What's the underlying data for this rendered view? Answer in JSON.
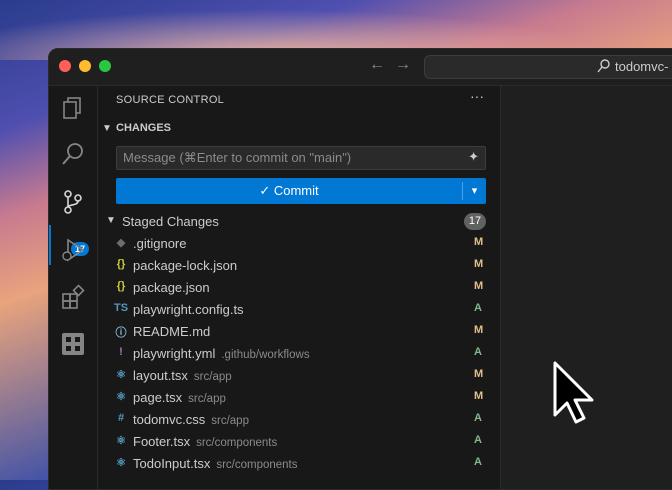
{
  "window": {
    "search_text": "todomvc-"
  },
  "activity_bar": {
    "items": [
      "explorer-icon",
      "search-icon",
      "source-control-icon",
      "run-debug-icon",
      "extensions-icon",
      "remote-icon"
    ],
    "scm_badge": "17",
    "accent": "#0078d4"
  },
  "source_control": {
    "title": "SOURCE CONTROL",
    "more": "···",
    "changes_header": "CHANGES",
    "message_placeholder": "Message (⌘Enter to commit on \"main\")",
    "commit_label": "✓ Commit",
    "staged_label": "Staged Changes",
    "staged_count": "17",
    "files": [
      {
        "icon": "◆",
        "icon_color": "#6d6d6d",
        "name": ".gitignore",
        "dir": "",
        "status": "M"
      },
      {
        "icon": "{}",
        "icon_color": "#cbcb41",
        "name": "package-lock.json",
        "dir": "",
        "status": "M"
      },
      {
        "icon": "{}",
        "icon_color": "#cbcb41",
        "name": "package.json",
        "dir": "",
        "status": "M"
      },
      {
        "icon": "TS",
        "icon_color": "#519aba",
        "name": "playwright.config.ts",
        "dir": "",
        "status": "A"
      },
      {
        "icon": "ⓘ",
        "icon_color": "#8bb8d8",
        "name": "README.md",
        "dir": "",
        "status": "M"
      },
      {
        "icon": "!",
        "icon_color": "#a074c4",
        "name": "playwright.yml",
        "dir": ".github/workflows",
        "status": "A"
      },
      {
        "icon": "⚛",
        "icon_color": "#519aba",
        "name": "layout.tsx",
        "dir": "src/app",
        "status": "M"
      },
      {
        "icon": "⚛",
        "icon_color": "#519aba",
        "name": "page.tsx",
        "dir": "src/app",
        "status": "M"
      },
      {
        "icon": "#",
        "icon_color": "#519aba",
        "name": "todomvc.css",
        "dir": "src/app",
        "status": "A"
      },
      {
        "icon": "⚛",
        "icon_color": "#519aba",
        "name": "Footer.tsx",
        "dir": "src/components",
        "status": "A"
      },
      {
        "icon": "⚛",
        "icon_color": "#519aba",
        "name": "TodoInput.tsx",
        "dir": "src/components",
        "status": "A"
      }
    ]
  }
}
